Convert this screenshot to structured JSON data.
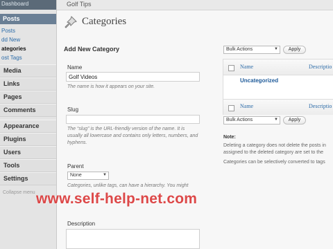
{
  "sidebar": {
    "top_item": "Dashboard",
    "posts_label": "Posts",
    "subitems": [
      "Posts",
      "dd New",
      "ategories",
      "ost Tags"
    ],
    "items": [
      "Media",
      "Links",
      "Pages",
      "Comments",
      "Appearance",
      "Plugins",
      "Users",
      "Tools",
      "Settings"
    ],
    "collapse": "Collapse menu"
  },
  "header": {
    "site": "Golf Tips"
  },
  "page": {
    "title": "Categories"
  },
  "form": {
    "heading": "Add New Category",
    "name_label": "Name",
    "name_value": "Golf Videos",
    "name_hint": "The name is how it appears on your site.",
    "slug_label": "Slug",
    "slug_hint": "The “slug” is the URL-friendly version of the name. It is usually all lowercase and contains only letters, numbers, and hyphens.",
    "parent_label": "Parent",
    "parent_value": "None",
    "parent_hint": "Categories, unlike tags, can have a hierarchy. You might",
    "description_label": "Description"
  },
  "bulk": {
    "select": "Bulk Actions",
    "apply": "Apply"
  },
  "table": {
    "col_name": "Name",
    "col_description": "Descriptio",
    "rows": [
      {
        "name": "Uncategorized"
      }
    ]
  },
  "note": {
    "title": "Note:",
    "line1": "Deleting a category does not delete the posts in",
    "line2": "assigned to the deleted category are set to the",
    "line3": "Categories can be selectively converted to tags"
  },
  "watermark": "www.self-help-net.com",
  "colors": {
    "sidebar_active": "#6a7f95",
    "link": "#2b6ba8",
    "watermark": "#d72828"
  }
}
